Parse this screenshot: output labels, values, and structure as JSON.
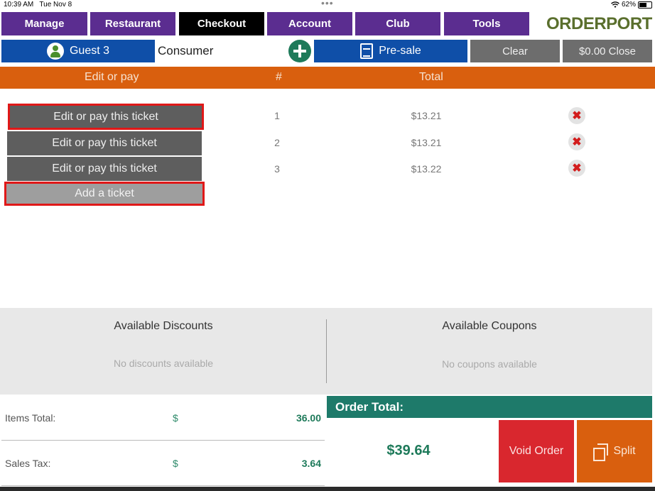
{
  "status_bar": {
    "time": "10:39 AM",
    "date": "Tue Nov 8",
    "wifi_icon": "wifi-icon",
    "battery": "62%",
    "battery_level": 0.62
  },
  "nav": {
    "items": [
      {
        "label": "Manage",
        "active": false
      },
      {
        "label": "Restaurant",
        "active": false
      },
      {
        "label": "Checkout",
        "active": true
      },
      {
        "label": "Account",
        "active": false
      },
      {
        "label": "Club",
        "active": false
      },
      {
        "label": "Tools",
        "active": false
      }
    ],
    "logo_text": "ORDERPORT"
  },
  "customer": {
    "name": "Guest 3",
    "type": "Consumer"
  },
  "toolbar": {
    "presale_label": "Pre-sale",
    "clear_label": "Clear",
    "close_label": "$0.00 Close"
  },
  "ticket_header": {
    "edit_col": "Edit or pay",
    "num_col": "#",
    "total_col": "Total"
  },
  "tickets": [
    {
      "label": "Edit or pay this ticket",
      "num": "1",
      "total": "$13.21"
    },
    {
      "label": "Edit or pay this ticket",
      "num": "2",
      "total": "$13.21"
    },
    {
      "label": "Edit or pay this ticket",
      "num": "3",
      "total": "$13.22"
    }
  ],
  "add_ticket_label": "Add a ticket",
  "discounts": {
    "title": "Available Discounts",
    "empty": "No discounts available"
  },
  "coupons": {
    "title": "Available Coupons",
    "empty": "No coupons available"
  },
  "summary": {
    "items_total_label": "Items Total:",
    "items_total_currency": "$",
    "items_total_value": "36.00",
    "sales_tax_label": "Sales Tax:",
    "sales_tax_currency": "$",
    "sales_tax_value": "3.64"
  },
  "order_total": {
    "label": "Order Total:",
    "value": "$39.64"
  },
  "actions": {
    "void_label": "Void Order",
    "split_label": "Split"
  },
  "colors": {
    "nav": "#5b2d90",
    "nav_active": "#000000",
    "blue": "#0f4fa8",
    "orange": "#d95f0e",
    "teal": "#1e7a6a",
    "red": "#d9272e"
  }
}
